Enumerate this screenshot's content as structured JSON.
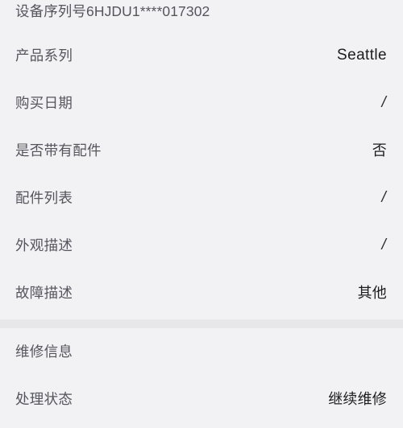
{
  "theme": {
    "background": "#f2f2f4",
    "divider": "#e7e7e9",
    "label_color": "#55555d",
    "value_color": "#1c1c1e"
  },
  "device_section": {
    "serial_row": {
      "label": "设备序列号6HJDU1****017302",
      "label_prefix": "设备序列号",
      "serial": "6HJDU1****017302"
    },
    "rows": [
      {
        "label": "产品系列",
        "value": "Seattle",
        "value_type": "latin"
      },
      {
        "label": "购买日期",
        "value": "/",
        "value_type": "slash"
      },
      {
        "label": "是否带有配件",
        "value": "否",
        "value_type": "cjk"
      },
      {
        "label": "配件列表",
        "value": "/",
        "value_type": "slash"
      },
      {
        "label": "外观描述",
        "value": "/",
        "value_type": "slash"
      },
      {
        "label": "故障描述",
        "value": "其他",
        "value_type": "cjk"
      }
    ]
  },
  "repair_section": {
    "heading": "维修信息",
    "rows": [
      {
        "label": "处理状态",
        "value": "继续维修",
        "value_type": "cjk"
      }
    ]
  }
}
